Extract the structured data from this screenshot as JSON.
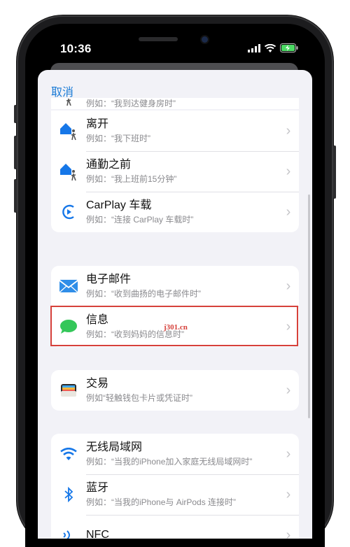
{
  "status": {
    "time": "10:36"
  },
  "sheet": {
    "cancel_label": "取消"
  },
  "partial_top": {
    "subtitle": "例如：“我到达健身房时”"
  },
  "group1": [
    {
      "title": "离开",
      "subtitle": "例如：“我下班时”",
      "icon": "house-walking-icon"
    },
    {
      "title": "通勤之前",
      "subtitle": "例如：“我上班前15分钟”",
      "icon": "house-walking-icon"
    },
    {
      "title": "CarPlay 车载",
      "subtitle": "例如：“连接 CarPlay 车载时”",
      "icon": "carplay-icon"
    }
  ],
  "group2": [
    {
      "title": "电子邮件",
      "subtitle": "例如：“收到曲扬的电子邮件时”",
      "icon": "mail-icon"
    },
    {
      "title": "信息",
      "subtitle": "例如：“收到妈妈的信息时”",
      "icon": "messages-icon"
    }
  ],
  "group3": [
    {
      "title": "交易",
      "subtitle": "例如“轻触钱包卡片或凭证时”",
      "icon": "wallet-icon"
    }
  ],
  "group4": [
    {
      "title": "无线局域网",
      "subtitle": "例如：“当我的iPhone加入家庭无线局域网时”",
      "icon": "wifi-icon"
    },
    {
      "title": "蓝牙",
      "subtitle": "例如：“当我的iPhone与 AirPods 连接时”",
      "icon": "bluetooth-icon"
    },
    {
      "title": "NFC",
      "subtitle": "",
      "icon": "nfc-icon"
    }
  ],
  "watermark": "j301.cn",
  "colors": {
    "accent": "#1a7bd6",
    "highlight": "#d6413b",
    "messages": "#34c759"
  }
}
